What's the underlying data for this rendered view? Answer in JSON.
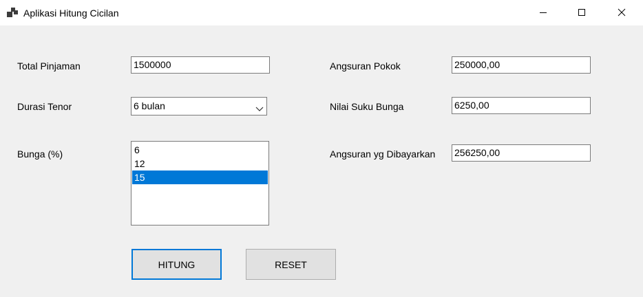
{
  "window": {
    "title": "Aplikasi Hitung Cicilan",
    "icon": "app-window-icon",
    "controls": [
      "minimize-icon",
      "maximize-icon",
      "close-icon"
    ]
  },
  "form": {
    "total_pinjaman": {
      "label": "Total Pinjaman",
      "value": "1500000"
    },
    "durasi_tenor": {
      "label": "Durasi Tenor",
      "selected": "6 bulan"
    },
    "bunga": {
      "label": "Bunga (%)",
      "items": [
        "6",
        "12",
        "15"
      ],
      "selected_index": 2
    },
    "angsuran_pokok": {
      "label": "Angsuran Pokok",
      "value": "250000,00"
    },
    "nilai_suku_bunga": {
      "label": "Nilai Suku Bunga",
      "value": "6250,00"
    },
    "angsuran_dibayarkan": {
      "label": "Angsuran yg Dibayarkan",
      "value": "256250,00"
    }
  },
  "buttons": {
    "hitung": "HITUNG",
    "reset": "RESET"
  },
  "colors": {
    "selection": "#0078d7",
    "focus_border": "#0078d7",
    "window_bg": "#f0f0f0",
    "button_bg": "#e1e1e1"
  }
}
